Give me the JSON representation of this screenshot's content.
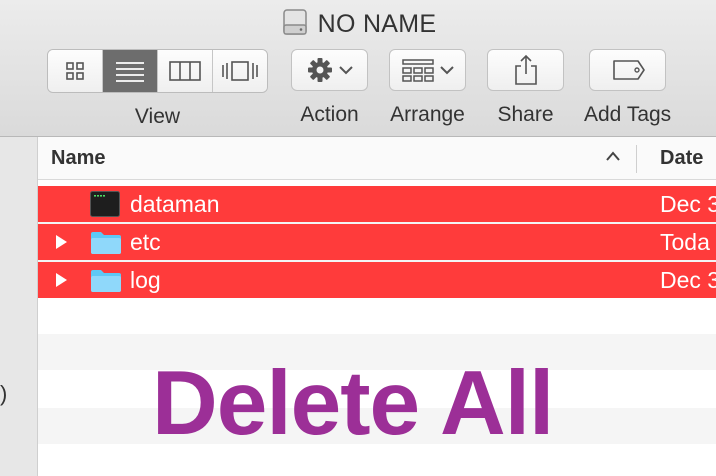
{
  "window": {
    "title": "NO NAME",
    "title_icon": "disk-icon"
  },
  "toolbar": {
    "view_label": "View",
    "view_modes": [
      "icon-view",
      "list-view",
      "column-view",
      "cover-flow-view"
    ],
    "view_active": "list-view",
    "action_label": "Action",
    "arrange_label": "Arrange",
    "share_label": "Share",
    "add_tags_label": "Add Tags"
  },
  "sidebar": {
    "visible_fragment": ")"
  },
  "list": {
    "columns": {
      "name": "Name",
      "date": "Date"
    },
    "sort": "ascending",
    "rows": [
      {
        "name": "dataman",
        "date": "Dec 3",
        "kind": "terminal",
        "selected": true,
        "expandable": false
      },
      {
        "name": "etc",
        "date": "Toda",
        "kind": "folder",
        "selected": true,
        "expandable": true
      },
      {
        "name": "log",
        "date": "Dec 3",
        "kind": "folder",
        "selected": true,
        "expandable": true
      }
    ],
    "selection_color": "#ff3b3b"
  },
  "overlay": {
    "text": "Delete All",
    "color": "#9c2f97"
  }
}
